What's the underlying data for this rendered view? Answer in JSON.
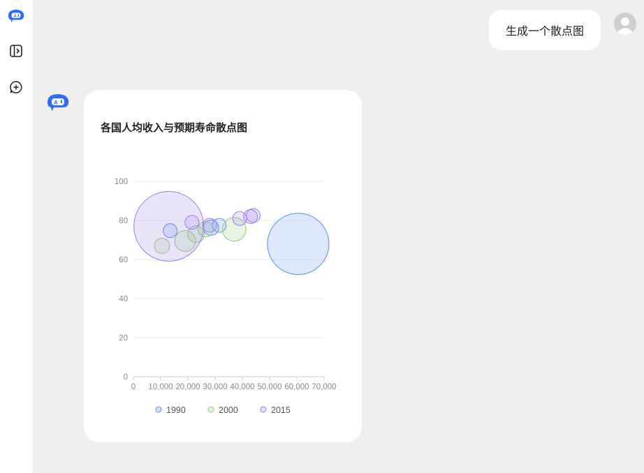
{
  "sidebar": {
    "items": [
      {
        "icon": "robot-logo-icon"
      },
      {
        "icon": "sidebar-toggle-icon"
      },
      {
        "icon": "new-chat-icon"
      }
    ]
  },
  "chat": {
    "user_message": "生成一个散点图",
    "bot_card_title": "各国人均收入与预期寿命散点图"
  },
  "colors": {
    "accent": "#2f6bff",
    "series_1990": "#5b8ff9",
    "series_2000": "#91cc75",
    "series_2015": "#9a7df0"
  },
  "chart_data": {
    "type": "scatter",
    "title": "",
    "xlabel": "",
    "ylabel": "",
    "xlim": [
      0,
      70000
    ],
    "ylim": [
      0,
      100
    ],
    "x_ticks": [
      "0",
      "10,000",
      "20,000",
      "30,000",
      "40,000",
      "50,000",
      "60,000",
      "70,000"
    ],
    "y_ticks": [
      "0",
      "20",
      "40",
      "60",
      "80",
      "100"
    ],
    "grid": true,
    "legend_position": "bottom",
    "series": [
      {
        "name": "1990",
        "color": "#5b8ff9",
        "points": [
          {
            "x": 13500,
            "y": 74.8,
            "size": 10
          },
          {
            "x": 28500,
            "y": 76.3,
            "size": 11
          },
          {
            "x": 31500,
            "y": 77.5,
            "size": 10
          },
          {
            "x": 60500,
            "y": 68.0,
            "size": 44
          }
        ]
      },
      {
        "name": "2000",
        "color": "#91cc75",
        "points": [
          {
            "x": 10500,
            "y": 67.0,
            "size": 11
          },
          {
            "x": 19000,
            "y": 69.5,
            "size": 15
          },
          {
            "x": 23000,
            "y": 73.0,
            "size": 12
          },
          {
            "x": 26500,
            "y": 75.5,
            "size": 11
          },
          {
            "x": 37000,
            "y": 75.5,
            "size": 17
          }
        ]
      },
      {
        "name": "2015",
        "color": "#9a7df0",
        "points": [
          {
            "x": 13000,
            "y": 77.0,
            "size": 50
          },
          {
            "x": 21500,
            "y": 79.0,
            "size": 10
          },
          {
            "x": 28000,
            "y": 77.5,
            "size": 10
          },
          {
            "x": 39000,
            "y": 81.0,
            "size": 10
          },
          {
            "x": 43000,
            "y": 82.0,
            "size": 10
          },
          {
            "x": 44000,
            "y": 82.5,
            "size": 10
          }
        ]
      }
    ]
  }
}
